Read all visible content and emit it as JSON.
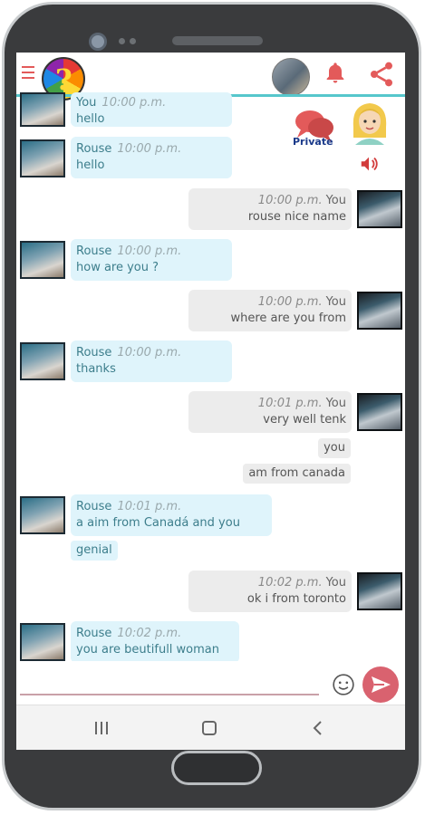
{
  "header": {
    "menu_icon": "hamburger-menu-icon",
    "logo_mark": "?",
    "bell_icon": "bell-icon",
    "share_icon": "share-icon",
    "accent_color": "#56c7cc"
  },
  "sidebar_widgets": {
    "private_label": "Private",
    "private_icon": "speech-bubbles-icon",
    "avatar_icon": "blonde-girl-avatar-icon",
    "volume_icon": "volume-icon"
  },
  "messages": [
    {
      "side": "left",
      "name": "You",
      "time": "10:00 p.m.",
      "text": "hello"
    },
    {
      "side": "left",
      "name": "Rouse",
      "time": "10:00 p.m.",
      "text": "hello"
    },
    {
      "side": "right",
      "name": "You",
      "time": "10:00 p.m.",
      "text": "rouse nice name"
    },
    {
      "side": "left",
      "name": "Rouse",
      "time": "10:00 p.m.",
      "text": "how are you ?"
    },
    {
      "side": "right",
      "name": "You",
      "time": "10:00 p.m.",
      "text": "where are you from"
    },
    {
      "side": "left",
      "name": "Rouse",
      "time": "10:00 p.m.",
      "text": "thanks"
    },
    {
      "side": "right",
      "name": "You",
      "time": "10:01 p.m.",
      "text": "very well tenk"
    },
    {
      "side": "right",
      "text": "you"
    },
    {
      "side": "right",
      "text": "am from canada"
    },
    {
      "side": "left",
      "name": "Rouse",
      "time": "10:01 p.m.",
      "text": "a aim from Canadá and you"
    },
    {
      "side": "left",
      "text": "genial"
    },
    {
      "side": "right",
      "name": "You",
      "time": "10:02 p.m.",
      "text": "ok i from toronto"
    },
    {
      "side": "left",
      "name": "Rouse",
      "time": "10:02 p.m.",
      "text": "you are beutifull woman"
    }
  ],
  "composer": {
    "value": "",
    "emoji_icon": "smiley-icon",
    "send_icon": "send-icon",
    "send_color": "#d9626f"
  },
  "navbar": {
    "recents_icon": "recents-icon",
    "home_icon": "home-square-icon",
    "back_icon": "back-chevron-icon"
  }
}
